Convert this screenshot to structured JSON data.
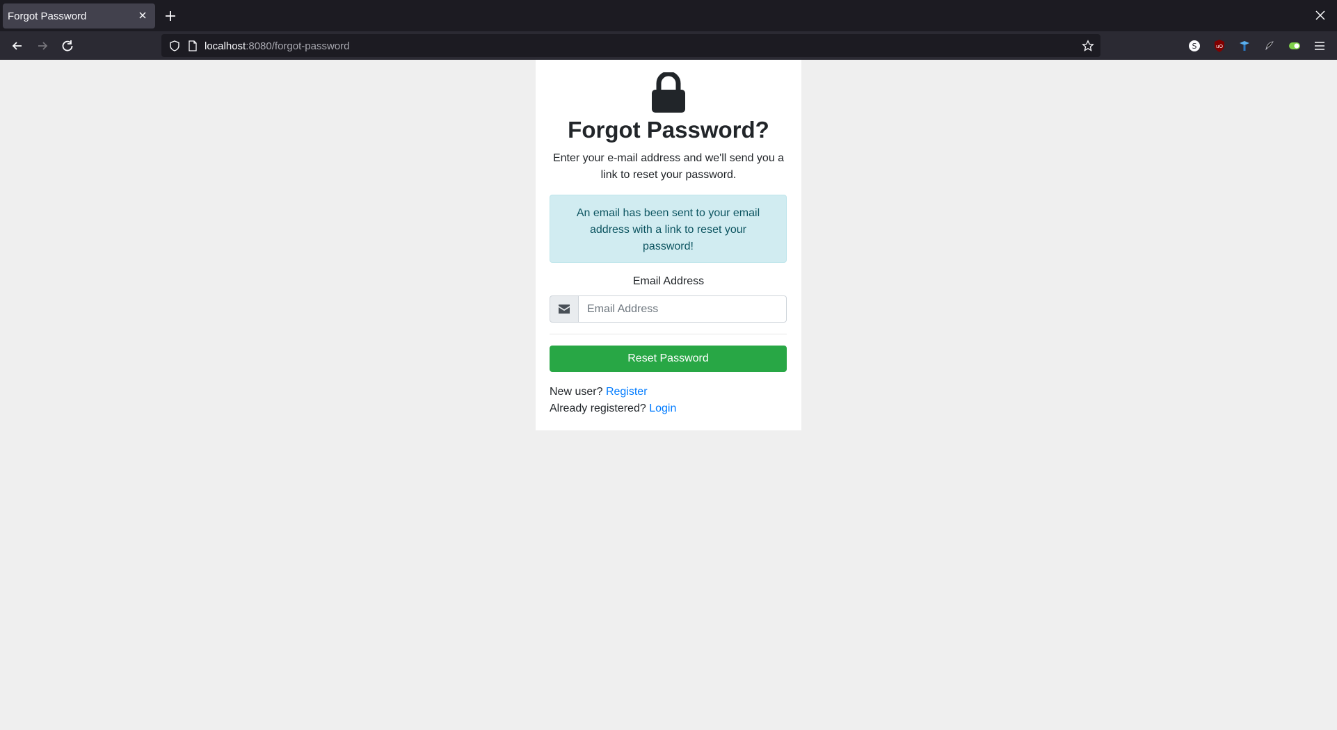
{
  "browser": {
    "tab_title": "Forgot Password",
    "url_host": "localhost",
    "url_path": ":8080/forgot-password"
  },
  "page": {
    "title": "Forgot Password?",
    "description": "Enter your e-mail address and we'll send you a link to reset your password.",
    "alert": "An email has been sent to your email address with a link to reset your password!",
    "email_label": "Email Address",
    "email_placeholder": "Email Address",
    "email_value": "",
    "submit_label": "Reset Password",
    "new_user_text": "New user?",
    "register_link": "Register",
    "already_text": "Already registered?",
    "login_link": "Login"
  },
  "colors": {
    "success": "#28a745",
    "link": "#007bff",
    "alert_bg": "#d1ecf1",
    "alert_text": "#0c5460"
  }
}
